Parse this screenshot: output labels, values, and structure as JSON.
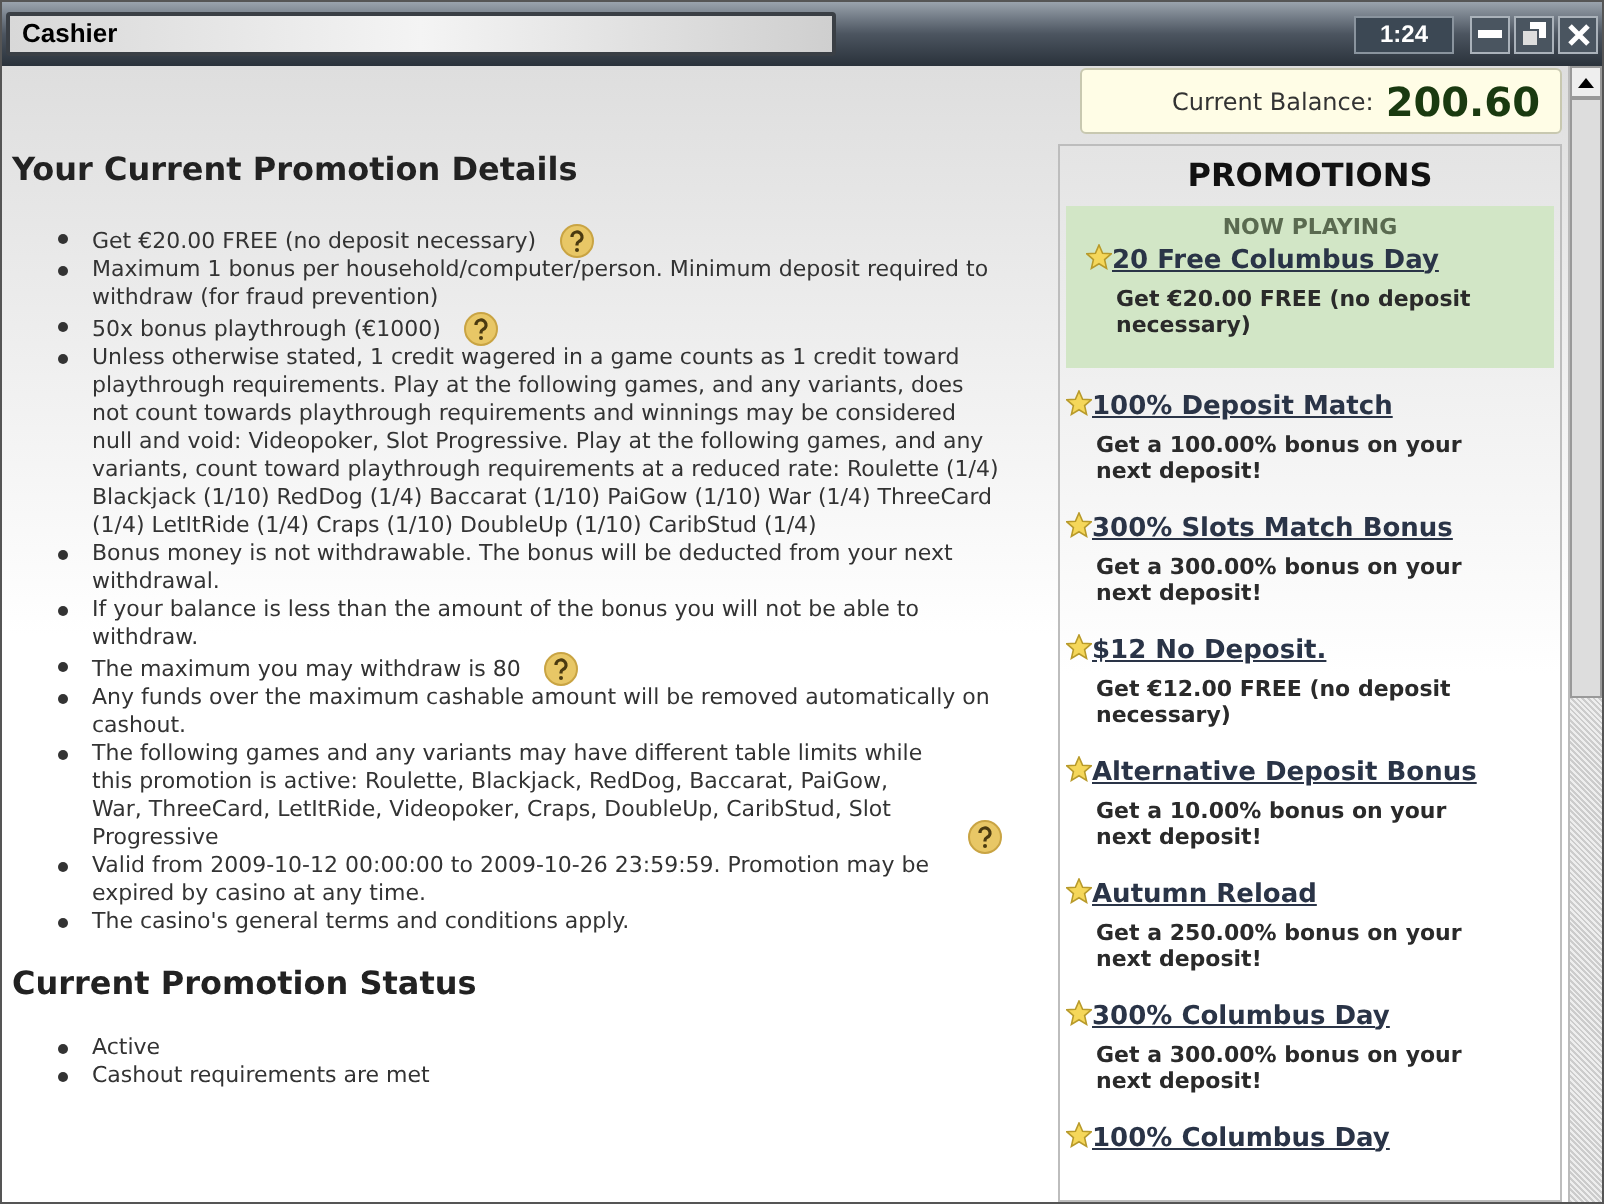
{
  "window": {
    "title": "Cashier",
    "clock": "1:24"
  },
  "balance": {
    "label": "Current Balance:",
    "value": "200.60"
  },
  "details": {
    "heading": "Your Current Promotion Details",
    "items": [
      {
        "text": "Get €20.00 FREE (no deposit necessary)",
        "help": true
      },
      {
        "text": "Maximum 1 bonus per household/computer/person. Minimum deposit required to withdraw (for fraud prevention)",
        "help": false
      },
      {
        "text": "50x bonus playthrough (€1000)",
        "help": true
      },
      {
        "text": "Unless otherwise stated, 1 credit wagered in a game counts as 1 credit toward playthrough requirements. Play at the following games, and any variants, does not count towards playthrough requirements and winnings may be considered null and void: Videopoker, Slot Progressive. Play at the following games, and any variants, count toward playthrough requirements at a reduced rate: Roulette (1/4) Blackjack (1/10) RedDog (1/4) Baccarat (1/10) PaiGow (1/10) War (1/4) ThreeCard (1/4) LetItRide (1/4) Craps (1/10) DoubleUp (1/10) CaribStud (1/4)",
        "help": false
      },
      {
        "text": "Bonus money is not withdrawable. The bonus will be deducted from your next withdrawal.",
        "help": false
      },
      {
        "text": "If your balance is less than the amount of the bonus you will not be able to withdraw.",
        "help": false
      },
      {
        "text": "The maximum you may withdraw is 80",
        "help": true
      },
      {
        "text": "Any funds over the maximum cashable amount will be removed automatically on cashout.",
        "help": false
      },
      {
        "text": "The following games and any variants may have different table limits while this promotion is active: Roulette, Blackjack, RedDog, Baccarat, PaiGow, War, ThreeCard, LetItRide, Videopoker, Craps, DoubleUp, CaribStud, Slot Progressive",
        "help": true
      },
      {
        "text": "Valid from 2009-10-12 00:00:00 to 2009-10-26 23:59:59. Promotion may be expired by casino at any time.",
        "help": false
      },
      {
        "text": "The casino's general terms and conditions apply.",
        "help": false
      }
    ]
  },
  "status": {
    "heading": "Current Promotion Status",
    "items": [
      "Active",
      "Cashout requirements are met"
    ]
  },
  "promotions": {
    "heading": "PROMOTIONS",
    "items": [
      {
        "badge": "NOW PLAYING",
        "title": "20 Free Columbus Day",
        "description": "Get €20.00 FREE (no deposit necessary)",
        "selected": true
      },
      {
        "title": "100% Deposit Match",
        "description": "Get a 100.00% bonus on your next deposit!",
        "selected": false
      },
      {
        "title": "300% Slots Match Bonus",
        "description": "Get a 300.00% bonus on your next deposit!",
        "selected": false
      },
      {
        "title": "$12 No Deposit.",
        "description": "Get €12.00 FREE (no deposit necessary)",
        "selected": false
      },
      {
        "title": "Alternative Deposit Bonus",
        "description": "Get a 10.00% bonus on your next deposit!",
        "selected": false
      },
      {
        "title": "Autumn Reload",
        "description": "Get a 250.00% bonus on your next deposit!",
        "selected": false
      },
      {
        "title": "300% Columbus Day",
        "description": "Get a 300.00% bonus on your next deposit!",
        "selected": false
      },
      {
        "title": "100% Columbus Day",
        "selected": false
      }
    ]
  }
}
